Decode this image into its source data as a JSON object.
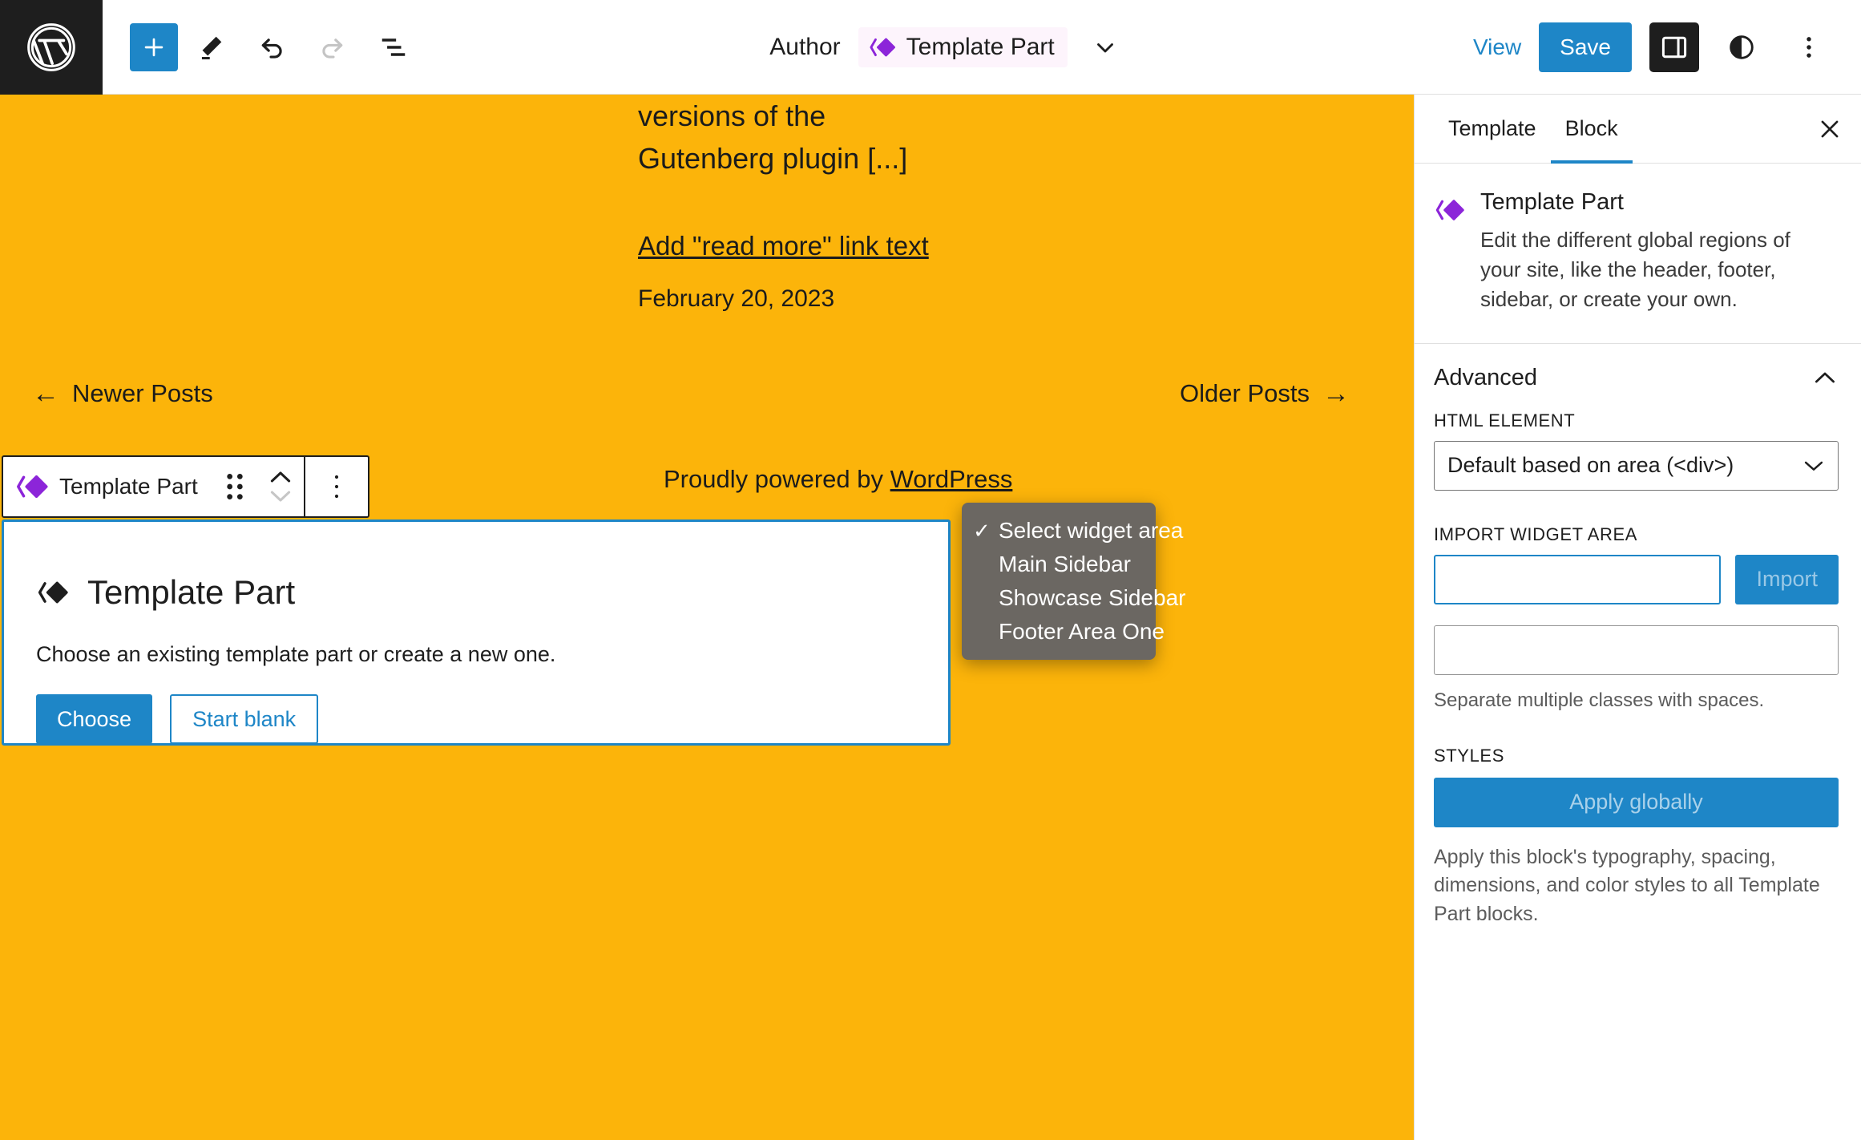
{
  "header": {
    "logo_icon": "wordpress-logo-icon",
    "add_block_label": "+",
    "tools": [
      {
        "name": "add-block-button",
        "icon": "plus-icon"
      },
      {
        "name": "edit-tool-button",
        "icon": "pencil-icon"
      },
      {
        "name": "undo-button",
        "icon": "undo-arrow-icon"
      },
      {
        "name": "redo-button",
        "icon": "redo-arrow-icon"
      },
      {
        "name": "list-view-button",
        "icon": "list-view-icon"
      }
    ],
    "document_type": "Author",
    "document_title": "Template Part",
    "document_icon": "template-part-icon",
    "chevron_icon": "chevron-down-icon",
    "view_label": "View",
    "save_label": "Save",
    "settings_sidebar_icon": "sidebar-panel-icon",
    "styles_icon": "half-circle-contrast-icon",
    "options_icon": "vertical-ellipsis-icon"
  },
  "canvas": {
    "background_color": "#fcb40a",
    "excerpt_tail": "versions of the Gutenberg plugin [...]",
    "read_more_label": "Add \"read more\" link text",
    "post_date": "February 20, 2023",
    "newer_posts_label": "Newer Posts",
    "newer_posts_arrow": "←",
    "older_posts_label": "Older Posts",
    "older_posts_arrow": "→",
    "powered_prefix": "Proudly powered by ",
    "powered_link": "WordPress"
  },
  "block_toolbar": {
    "block_icon": "template-part-icon",
    "block_label": "Template Part",
    "drag_icon": "drag-handle-icon",
    "move_up_icon": "chevron-up-icon",
    "move_down_icon": "chevron-down-icon",
    "more_options_icon": "vertical-ellipsis-icon"
  },
  "placeholder": {
    "icon": "template-part-icon",
    "title": "Template Part",
    "description": "Choose an existing template part or create a new one.",
    "choose_label": "Choose",
    "start_blank_label": "Start blank",
    "selection_color": "#1e86c7"
  },
  "sidebar": {
    "tabs": [
      {
        "label": "Template",
        "active": false
      },
      {
        "label": "Block",
        "active": true
      }
    ],
    "close_icon": "close-x-icon",
    "block_info": {
      "icon": "template-part-icon",
      "title": "Template Part",
      "description": "Edit the different global regions of your site, like the header, footer, sidebar, or create your own."
    },
    "advanced": {
      "panel_title": "Advanced",
      "collapse_icon": "chevron-up-icon",
      "html_element_label": "HTML ELEMENT",
      "html_element_value": "Default based on area (<div>)",
      "html_element_caret": "chevron-down-icon",
      "import_widget_label": "IMPORT WIDGET AREA",
      "import_button_label": "Import",
      "css_helper_text": "Separate multiple classes with spaces.",
      "css_classes_value": ""
    },
    "styles": {
      "label": "STYLES",
      "apply_globally_label": "Apply globally",
      "apply_description": "Apply this block's typography, spacing, dimensions, and color styles to all Template Part blocks."
    }
  },
  "widget_area_dropdown": {
    "options": [
      {
        "label": "Select widget area",
        "selected": true
      },
      {
        "label": "Main Sidebar",
        "selected": false
      },
      {
        "label": "Showcase Sidebar",
        "selected": false
      },
      {
        "label": "Footer Area One",
        "selected": false
      }
    ],
    "check_glyph": "✓",
    "background_color": "#6b6762"
  }
}
